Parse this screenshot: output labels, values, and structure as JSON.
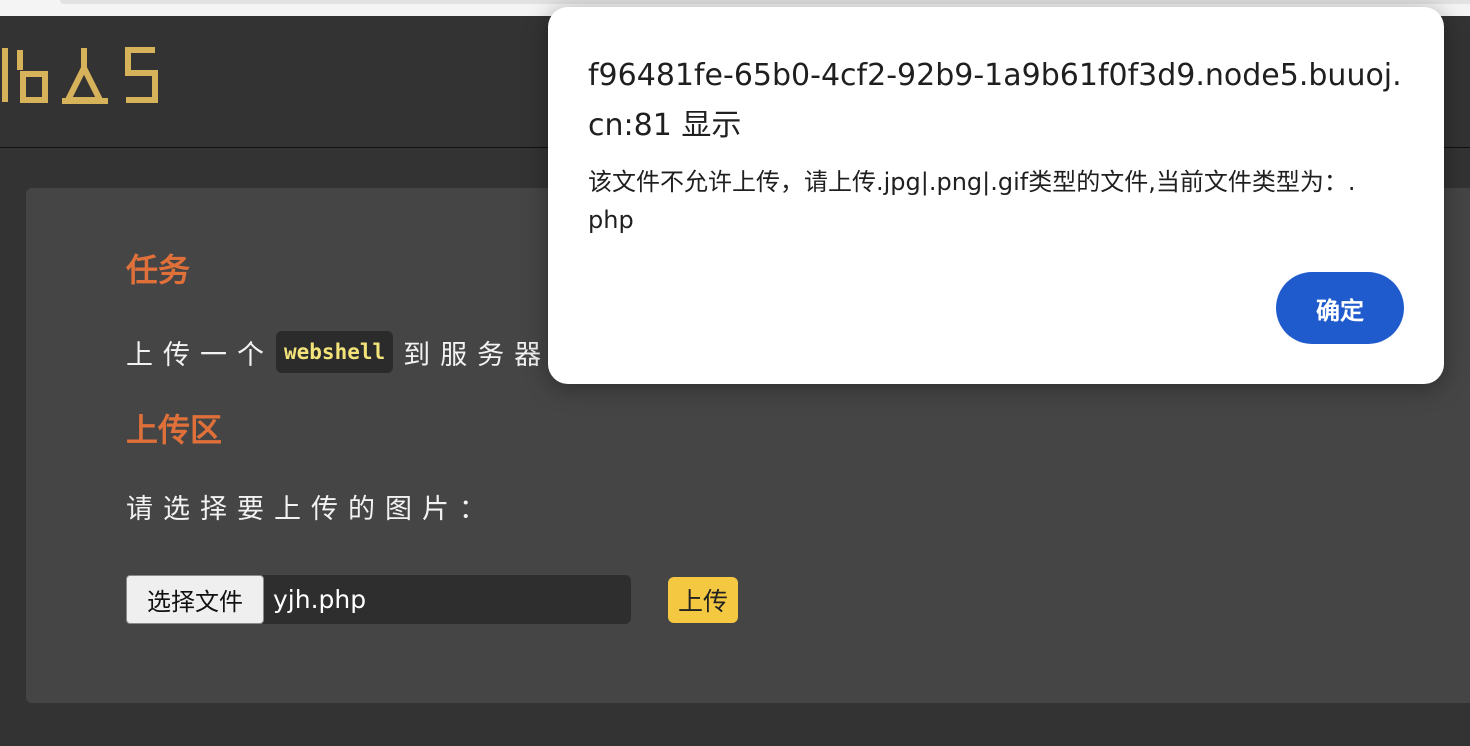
{
  "colors": {
    "background": "#333333",
    "panel": "#454545",
    "heading": "#e0703a",
    "code_text": "#f3e37a",
    "logo": "#d6b35a",
    "upload_button": "#f5c842",
    "dialog_ok_button": "#1f5bcd"
  },
  "header": {
    "logo_icon": "ctf-logo-icon"
  },
  "main": {
    "task_heading": "任务",
    "task_text_before": "上传一个",
    "task_code": "webshell",
    "task_text_after": "到服务器",
    "upload_heading": "上传区",
    "choose_prompt": "请选择要上传的图片：",
    "file_button_label": "选择文件",
    "file_name": "yjh.php",
    "upload_button_label": "上传"
  },
  "dialog": {
    "title": "f96481fe-65b0-4cf2-92b9-1a9b61f0f3d9.node5.buuoj.cn:81 显示",
    "message": "该文件不允许上传，请上传.jpg|.png|.gif类型的文件,当前文件类型为：.php",
    "ok_label": "确定"
  }
}
